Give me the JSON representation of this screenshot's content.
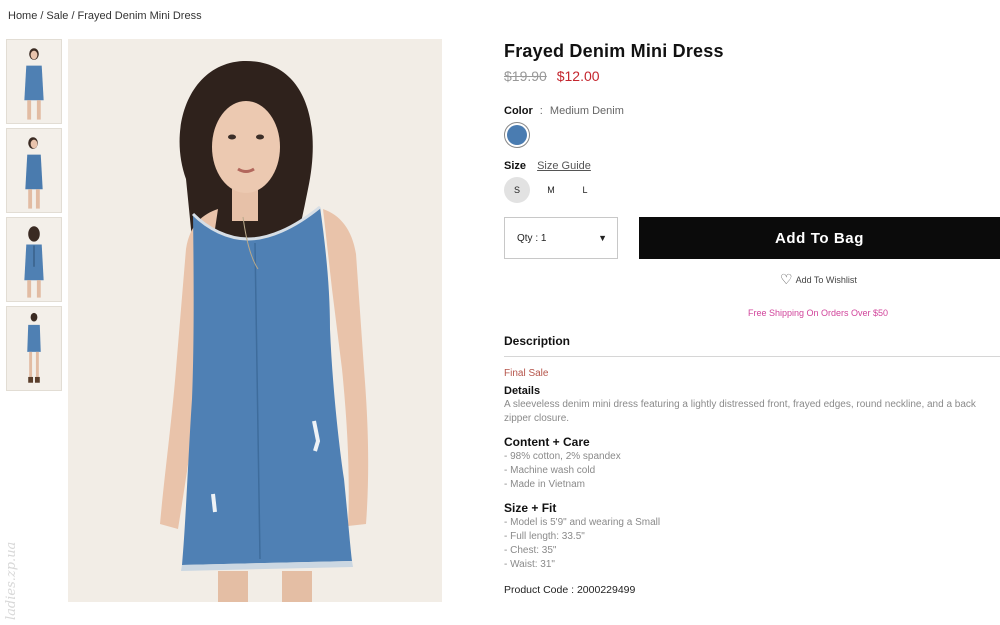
{
  "breadcrumb": {
    "home": "Home",
    "sale": "Sale",
    "current": "Frayed Denim Mini Dress",
    "separator": "/"
  },
  "product": {
    "title": "Frayed Denim Mini Dress",
    "price_old": "$19.90",
    "price_new": "$12.00",
    "color_label": "Color",
    "color_colon": ":",
    "color_value": "Medium Denim",
    "swatch_color": "#4a7cb1",
    "size_label": "Size",
    "size_guide": "Size Guide",
    "sizes": [
      "S",
      "M",
      "L"
    ],
    "selected_size": "S",
    "qty_label": "Qty : 1",
    "add_to_bag": "Add To Bag",
    "wishlist": "Add To Wishlist",
    "shipping": "Free Shipping On Orders Over $50"
  },
  "description": {
    "title": "Description",
    "final_sale": "Final Sale",
    "details_title": "Details",
    "details_text": "A sleeveless denim mini dress featuring a lightly distressed front, frayed edges, round neckline, and a back zipper closure.",
    "content_title": "Content + Care",
    "content_items": [
      "- 98% cotton, 2% spandex",
      "- Machine wash cold",
      "- Made in Vietnam"
    ],
    "fit_title": "Size + Fit",
    "fit_items": [
      "- Model is 5'9\" and wearing a Small",
      "- Full length: 33.5\"",
      "- Chest: 35\"",
      "- Waist: 31\""
    ],
    "product_code": "Product Code : 2000229499"
  },
  "watermark": "ladies.zp.ua",
  "colors": {
    "accent_sale": "#c4262e",
    "shipping": "#d1449b",
    "button_bg": "#0b0b0b"
  }
}
